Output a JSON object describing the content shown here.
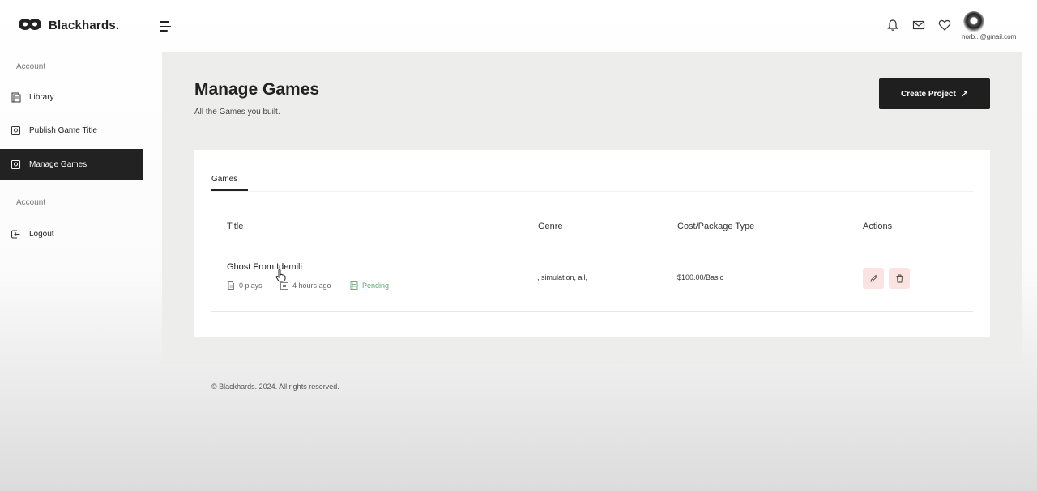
{
  "brand": {
    "name": "Blackhards."
  },
  "header": {
    "icons": [
      "bell-icon",
      "mail-icon",
      "heart-icon"
    ],
    "user_email": "norb...@gmail.com"
  },
  "sidebar": {
    "section_1": "Account",
    "items": [
      {
        "label": "Library",
        "icon": "library-icon"
      },
      {
        "label": "Publish Game Title",
        "icon": "publish-icon"
      },
      {
        "label": "Manage Games",
        "icon": "manage-icon",
        "active": true
      }
    ],
    "section_2": "Account",
    "logout": {
      "label": "Logout",
      "icon": "logout-icon"
    }
  },
  "main": {
    "title": "Manage Games",
    "subtitle": "All the Games you built.",
    "create_button": "Create Project",
    "tab": "Games",
    "columns": {
      "title": "Title",
      "genre": "Genre",
      "cost": "Cost/Package Type",
      "actions": "Actions"
    },
    "rows": [
      {
        "title": "Ghost From Idemili",
        "plays": "0 plays",
        "time": "4 hours ago",
        "status": "Pending",
        "genre": ", simulation, all,",
        "cost": "$100.00/Basic"
      }
    ]
  },
  "footer": {
    "text": "© Blackhards. 2024. All rights reserved."
  },
  "colors": {
    "dark": "#1f1f1f",
    "panel": "#ededeb",
    "pending": "#5aa86e",
    "action_bg": "#fbe3e1"
  }
}
